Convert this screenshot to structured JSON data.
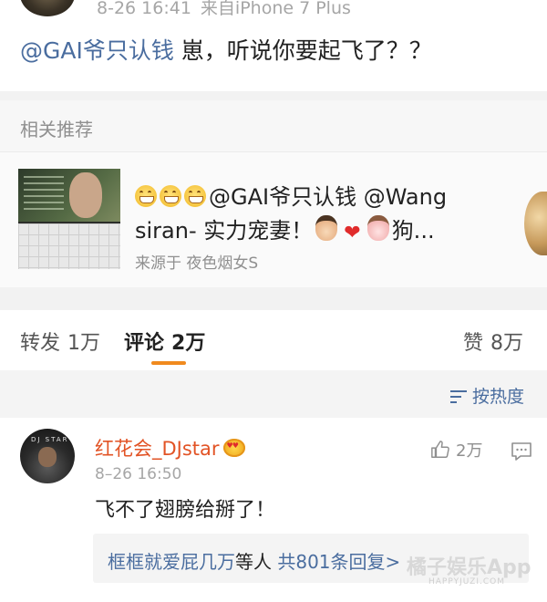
{
  "post": {
    "timestamp": "8-26 16:41",
    "source": "来自iPhone 7 Plus",
    "mention": "@GAI爷只认钱",
    "text": " 崽，听说你要起飞了？？"
  },
  "recommend": {
    "title": "相关推荐",
    "card": {
      "line1_text": "@GAI爷只认钱 @Wang",
      "line2_text": "siran- 实力宠妻！",
      "line2_tail": "狗...",
      "source": "来源于 夜色烟女S"
    }
  },
  "tabs": {
    "repost": {
      "label": "转发",
      "count": "1万"
    },
    "comment": {
      "label": "评论",
      "count": "2万"
    },
    "like": {
      "label": "赞",
      "count": "8万"
    }
  },
  "sort": {
    "label": "按热度"
  },
  "comment": {
    "username": "红花会_DJstar",
    "avatar_text": "DJ STAR",
    "time": "8–26 16:50",
    "likes": "2万",
    "text": "飞不了翅膀给掰了！",
    "reply_name": "框框就爱屁几万",
    "reply_mid": "等人 ",
    "reply_count": "共801条回复",
    "reply_arrow": ">"
  },
  "watermark": {
    "main": "橘子娱乐App",
    "sub": "HAPPYJUZI.COM"
  },
  "colors": {
    "link": "#4a6d9f",
    "username": "#e25325",
    "active_tab": "#f08a1e",
    "muted": "#a6a6a6"
  }
}
